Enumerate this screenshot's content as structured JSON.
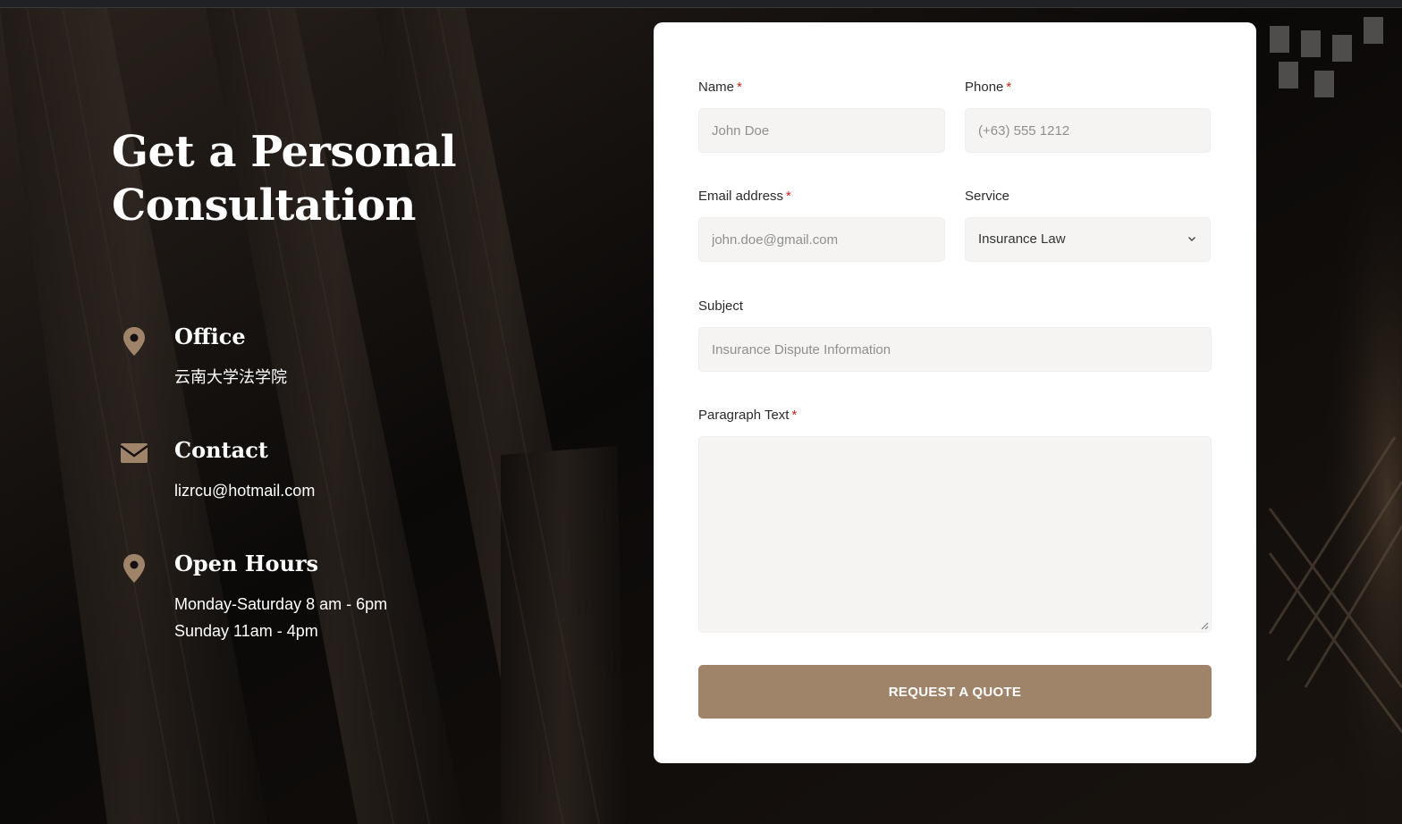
{
  "colors": {
    "accent": "#a0846a",
    "required": "#d11f1f",
    "field_bg": "#f5f4f2",
    "card_bg": "#ffffff"
  },
  "hero": {
    "title_line1": "Get a Personal",
    "title_line2": "Consultation"
  },
  "info": [
    {
      "icon": "map-pin-icon",
      "title": "Office",
      "lines": [
        "云南大学法学院"
      ]
    },
    {
      "icon": "envelope-icon",
      "title": "Contact",
      "lines": [
        "lizrcu@hotmail.com"
      ]
    },
    {
      "icon": "map-pin-icon",
      "title": "Open Hours",
      "lines": [
        "Monday-Saturday 8 am - 6pm",
        "Sunday 11am - 4pm"
      ]
    }
  ],
  "form": {
    "required_mark": "*",
    "name": {
      "label": "Name",
      "placeholder": "John Doe"
    },
    "phone": {
      "label": "Phone",
      "placeholder": "(+63) 555 1212"
    },
    "email": {
      "label": "Email address",
      "placeholder": "john.doe@gmail.com"
    },
    "service": {
      "label": "Service",
      "selected": "Insurance Law",
      "icon": "chevron-down-icon"
    },
    "subject": {
      "label": "Subject",
      "placeholder": "Insurance Dispute Information"
    },
    "message": {
      "label": "Paragraph Text",
      "value": ""
    },
    "submit_label": "REQUEST A QUOTE"
  }
}
